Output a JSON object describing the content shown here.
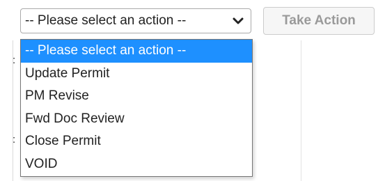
{
  "action_select": {
    "selected_label": "-- Please select an action --",
    "options": [
      {
        "label": "-- Please select an action --",
        "highlighted": true
      },
      {
        "label": "Update Permit",
        "highlighted": false
      },
      {
        "label": "PM Revise",
        "highlighted": false
      },
      {
        "label": "Fwd Doc Review",
        "highlighted": false
      },
      {
        "label": "Close Permit",
        "highlighted": false
      },
      {
        "label": "VOID",
        "highlighted": false
      }
    ]
  },
  "take_action_button": {
    "label": "Take Action",
    "disabled": true
  },
  "colors": {
    "highlight": "#1e90ff",
    "button_text_disabled": "#9a9a9a",
    "border": "#aaaaaa"
  },
  "icons": {
    "select_arrow": "chevron-down-icon"
  }
}
